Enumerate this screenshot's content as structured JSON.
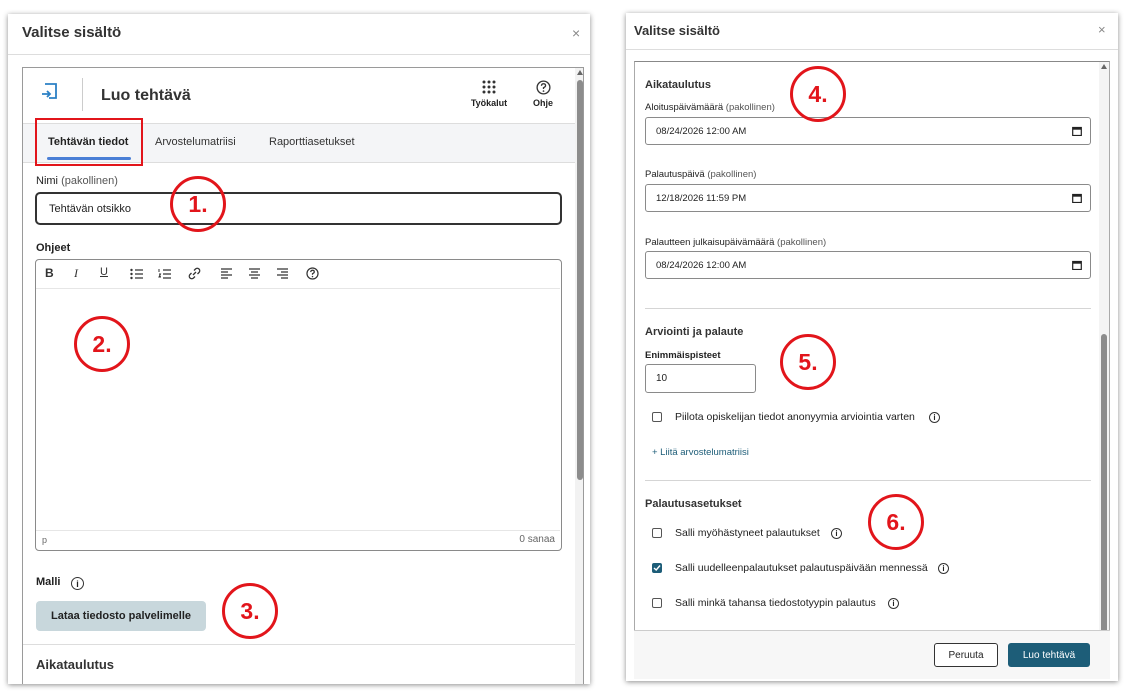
{
  "left": {
    "dialog_title": "Valitse sisältö",
    "close": "×",
    "header": {
      "title": "Luo tehtävä",
      "tools_label": "Työkalut",
      "help_label": "Ohje"
    },
    "tabs": [
      {
        "label": "Tehtävän tiedot",
        "active": true
      },
      {
        "label": "Arvostelumatriisi",
        "active": false
      },
      {
        "label": "Raporttiasetukset",
        "active": false
      }
    ],
    "name_label": "Nimi",
    "name_required": "(pakollinen)",
    "name_value": "Tehtävän otsikko",
    "instructions_label": "Ohjeet",
    "editor_path": "p",
    "word_count": "0 sanaa",
    "template_label": "Malli",
    "upload_button": "Lataa tiedosto palvelimelle",
    "schedule_heading": "Aikataulutus"
  },
  "right": {
    "dialog_title": "Valitse sisältö",
    "close": "×",
    "schedule_heading": "Aikataulutus",
    "start_label": "Aloituspäivämäärä",
    "start_required": "(pakollinen)",
    "start_value": "08/24/2026 12:00 AM",
    "due_label": "Palautuspäivä",
    "due_required": "(pakollinen)",
    "due_value": "12/18/2026 11:59 PM",
    "feedback_release_label": "Palautteen julkaisupäivämäärä",
    "feedback_release_required": "(pakollinen)",
    "feedback_release_value": "08/24/2026 12:00 AM",
    "grading_heading": "Arviointi ja palaute",
    "max_points_label": "Enimmäispisteet",
    "max_points_value": "10",
    "anon_label": "Piilota opiskelijan tiedot anonyymia arviointia varten",
    "anon_checked": false,
    "attach_rubric": "+ Liitä arvostelumatriisi",
    "submission_heading": "Palautusasetukset",
    "options": [
      {
        "label": "Salli myöhästyneet palautukset",
        "checked": false
      },
      {
        "label": "Salli uudelleenpalautukset palautuspäivään mennessä",
        "checked": true
      },
      {
        "label": "Salli minkä tahansa tiedostotyypin palautus",
        "checked": false
      }
    ],
    "cancel_button": "Peruuta",
    "create_button": "Luo tehtävä"
  },
  "annotations": [
    "1.",
    "2.",
    "3.",
    "4.",
    "5.",
    "6."
  ],
  "colors": {
    "accent": "#1d5d78",
    "annotation": "#e2151b",
    "tab_underline": "#4a7fd6",
    "highlight_box": "#e2151b"
  }
}
